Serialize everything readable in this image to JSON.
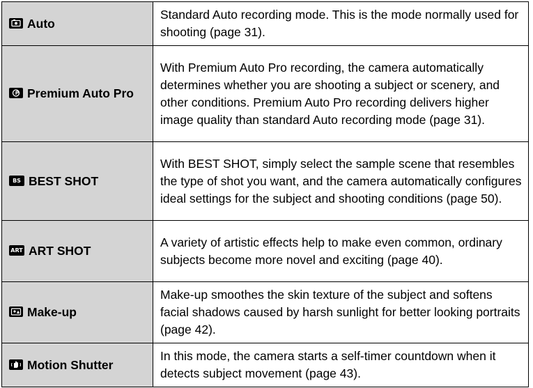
{
  "modes": [
    {
      "icon": "camera-auto-icon",
      "name": "Auto",
      "description": "Standard Auto recording mode. This is the mode normally used for shooting (page 31)."
    },
    {
      "icon": "premium-auto-pro-icon",
      "name": "Premium Auto Pro",
      "description": "With Premium Auto Pro recording, the camera automatically determines whether you are shooting a subject or scenery, and other conditions. Premium Auto Pro recording delivers higher image quality than standard Auto recording mode (page 31)."
    },
    {
      "icon": "best-shot-icon",
      "icon_text": "BS",
      "name": "BEST SHOT",
      "description": "With BEST SHOT, simply select the sample scene that resembles the type of shot you want, and the camera automatically configures ideal settings for the subject and shooting conditions (page 50)."
    },
    {
      "icon": "art-shot-icon",
      "icon_text": "ART",
      "name": "ART SHOT",
      "description": "A variety of artistic effects help to make even common, ordinary subjects become more novel and exciting (page 40)."
    },
    {
      "icon": "make-up-icon",
      "name": "Make-up",
      "description": "Make-up smoothes the skin texture of the subject and softens facial shadows caused by harsh sunlight for better looking portraits (page 42)."
    },
    {
      "icon": "motion-shutter-icon",
      "name": "Motion Shutter",
      "description": "In this mode, the camera starts a self-timer countdown when it detects subject movement (page 43)."
    }
  ]
}
